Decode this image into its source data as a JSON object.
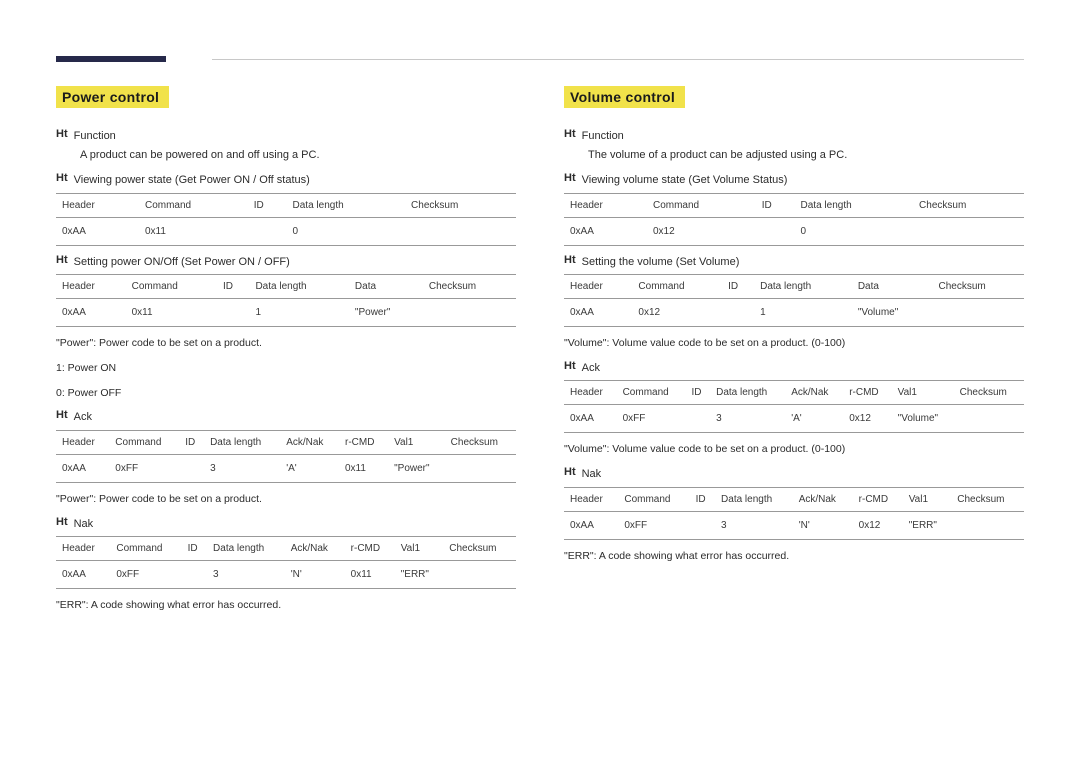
{
  "power": {
    "heading": "Power control",
    "s1": {
      "bullet": "Ht",
      "label": "Function",
      "desc": "A product can be powered on and off using a PC."
    },
    "s2": {
      "bullet": "Ht",
      "label": "Viewing power state (Get Power ON / Off status)",
      "headers": [
        "Header",
        "Command",
        "ID",
        "Data length",
        "Checksum"
      ],
      "row": [
        "0xAA",
        "0x11",
        "",
        "0",
        ""
      ]
    },
    "s3": {
      "bullet": "Ht",
      "label": "Setting power ON/Off (Set Power ON / OFF)",
      "headers": [
        "Header",
        "Command",
        "ID",
        "Data length",
        "Data",
        "Checksum"
      ],
      "row": [
        "0xAA",
        "0x11",
        "",
        "1",
        "\"Power\"",
        ""
      ]
    },
    "note1": "\"Power\": Power code to be set on a product.",
    "note2": "1: Power ON",
    "note3": "0: Power OFF",
    "s4": {
      "bullet": "Ht",
      "label": "Ack",
      "headers": [
        "Header",
        "Command",
        "ID",
        "Data length",
        "Ack/Nak",
        "r-CMD",
        "Val1",
        "Checksum"
      ],
      "row": [
        "0xAA",
        "0xFF",
        "",
        "3",
        "'A'",
        "0x11",
        "\"Power\"",
        ""
      ]
    },
    "note4": "\"Power\": Power code to be set on a product.",
    "s5": {
      "bullet": "Ht",
      "label": "Nak",
      "headers": [
        "Header",
        "Command",
        "ID",
        "Data length",
        "Ack/Nak",
        "r-CMD",
        "Val1",
        "Checksum"
      ],
      "row": [
        "0xAA",
        "0xFF",
        "",
        "3",
        "'N'",
        "0x11",
        "\"ERR\"",
        ""
      ]
    },
    "note5": "\"ERR\": A code showing what error has occurred."
  },
  "volume": {
    "heading": "Volume control",
    "s1": {
      "bullet": "Ht",
      "label": "Function",
      "desc": "The volume of a product can be adjusted using a PC."
    },
    "s2": {
      "bullet": "Ht",
      "label": "Viewing volume state (Get Volume Status)",
      "headers": [
        "Header",
        "Command",
        "ID",
        "Data length",
        "Checksum"
      ],
      "row": [
        "0xAA",
        "0x12",
        "",
        "0",
        ""
      ]
    },
    "s3": {
      "bullet": "Ht",
      "label": "Setting the volume (Set Volume)",
      "headers": [
        "Header",
        "Command",
        "ID",
        "Data length",
        "Data",
        "Checksum"
      ],
      "row": [
        "0xAA",
        "0x12",
        "",
        "1",
        "\"Volume\"",
        ""
      ]
    },
    "note1": "\"Volume\": Volume value code to be set on a product. (0-100)",
    "s4": {
      "bullet": "Ht",
      "label": "Ack",
      "headers": [
        "Header",
        "Command",
        "ID",
        "Data length",
        "Ack/Nak",
        "r-CMD",
        "Val1",
        "Checksum"
      ],
      "row": [
        "0xAA",
        "0xFF",
        "",
        "3",
        "'A'",
        "0x12",
        "\"Volume\"",
        ""
      ]
    },
    "note2": "\"Volume\": Volume value code to be set on a product. (0-100)",
    "s5": {
      "bullet": "Ht",
      "label": "Nak",
      "headers": [
        "Header",
        "Command",
        "ID",
        "Data length",
        "Ack/Nak",
        "r-CMD",
        "Val1",
        "Checksum"
      ],
      "row": [
        "0xAA",
        "0xFF",
        "",
        "3",
        "'N'",
        "0x12",
        "\"ERR\"",
        ""
      ]
    },
    "note3": "\"ERR\": A code showing what error has occurred."
  }
}
